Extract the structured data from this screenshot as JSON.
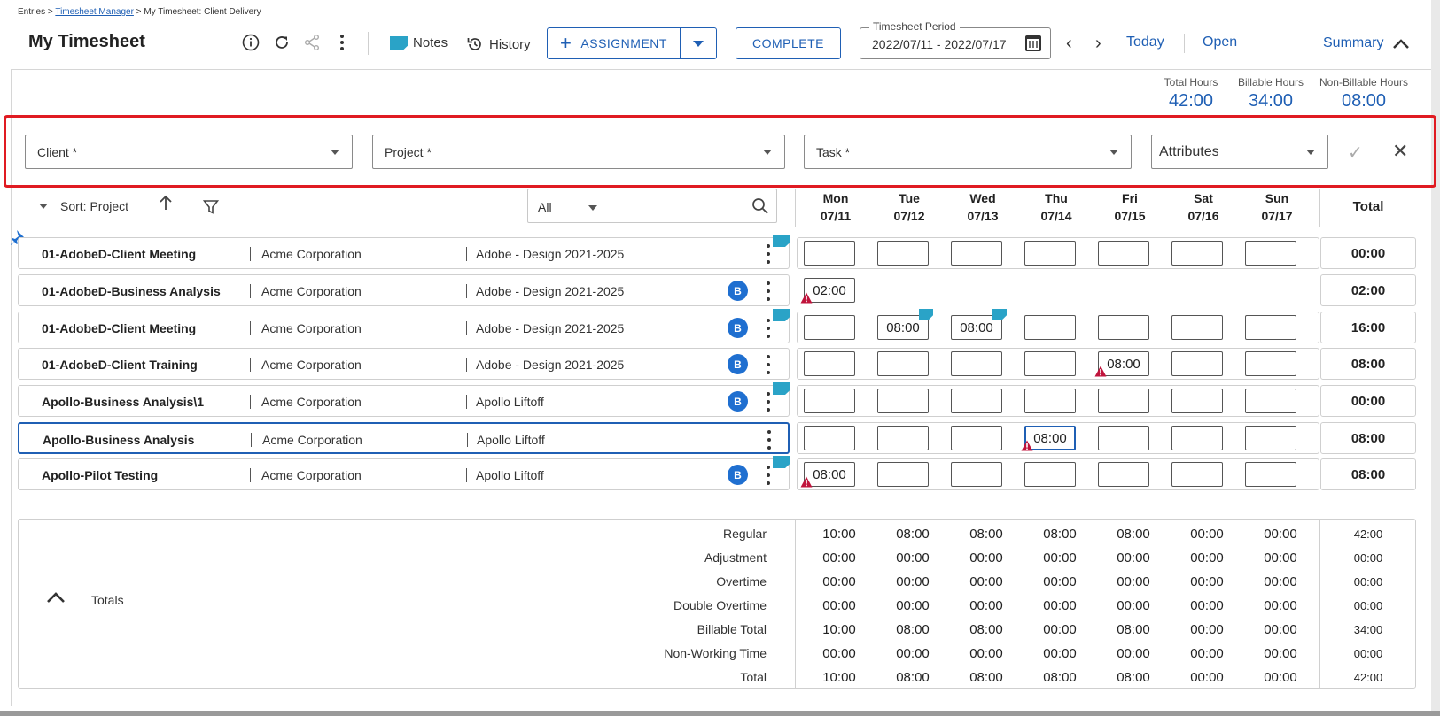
{
  "breadcrumb": {
    "entries": "Entries",
    "sep1": " > ",
    "manager": "Timesheet Manager",
    "sep2": " > ",
    "current": "My Timesheet: Client Delivery"
  },
  "header": {
    "title": "My Timesheet",
    "notes_label": "Notes",
    "history_label": "History",
    "assignment_label": "ASSIGNMENT",
    "complete_label": "COMPLETE",
    "period_label": "Timesheet Period",
    "period_value": "2022/07/11 - 2022/07/17",
    "today_label": "Today",
    "open_label": "Open",
    "summary_label": "Summary"
  },
  "stats": {
    "total_label": "Total Hours",
    "total_value": "42:00",
    "billable_label": "Billable Hours",
    "billable_value": "34:00",
    "nonbillable_label": "Non-Billable Hours",
    "nonbillable_value": "08:00"
  },
  "assignment_form": {
    "client": "Client *",
    "project": "Project *",
    "task": "Task *",
    "attributes": "Attributes"
  },
  "toolbar": {
    "sort_label": "Sort: Project",
    "filter_value": "All"
  },
  "days": [
    {
      "name": "Mon",
      "date": "07/11"
    },
    {
      "name": "Tue",
      "date": "07/12"
    },
    {
      "name": "Wed",
      "date": "07/13"
    },
    {
      "name": "Thu",
      "date": "07/14"
    },
    {
      "name": "Fri",
      "date": "07/15"
    },
    {
      "name": "Sat",
      "date": "07/16"
    },
    {
      "name": "Sun",
      "date": "07/17"
    }
  ],
  "total_header": "Total",
  "rows": [
    {
      "task": "01-AdobeD-Client Meeting",
      "client": "Acme Corporation",
      "project": "Adobe - Design 2021-2025",
      "badge": "",
      "total": "00:00",
      "hours": [
        "",
        "",
        "",
        "",
        "",
        "",
        ""
      ]
    },
    {
      "task": "01-AdobeD-Business Analysis",
      "client": "Acme Corporation",
      "project": "Adobe - Design 2021-2025",
      "badge": "B",
      "total": "02:00",
      "hours": [
        "02:00"
      ]
    },
    {
      "task": "01-AdobeD-Client Meeting",
      "client": "Acme Corporation",
      "project": "Adobe - Design 2021-2025",
      "badge": "B",
      "total": "16:00",
      "hours": [
        "",
        "08:00",
        "08:00",
        "",
        "",
        "",
        ""
      ]
    },
    {
      "task": "01-AdobeD-Client Training",
      "client": "Acme Corporation",
      "project": "Adobe - Design 2021-2025",
      "badge": "B",
      "total": "08:00",
      "hours": [
        "",
        "",
        "",
        "",
        "08:00",
        "",
        ""
      ]
    },
    {
      "task": "Apollo-Business Analysis\\1",
      "client": "Acme Corporation",
      "project": "Apollo Liftoff",
      "badge": "B",
      "total": "00:00",
      "hours": [
        "",
        "",
        "",
        "",
        "",
        "",
        ""
      ]
    },
    {
      "task": "Apollo-Business Analysis",
      "client": "Acme Corporation",
      "project": "Apollo Liftoff",
      "badge": "",
      "total": "08:00",
      "hours": [
        "",
        "",
        "",
        "08:00",
        "",
        "",
        ""
      ]
    },
    {
      "task": "Apollo-Pilot Testing",
      "client": "Acme Corporation",
      "project": "Apollo Liftoff",
      "badge": "B",
      "total": "08:00",
      "hours": [
        "08:00",
        "",
        "",
        "",
        "",
        "",
        ""
      ]
    }
  ],
  "totals": {
    "title": "Totals",
    "rows": [
      {
        "label": "Regular",
        "values": [
          "10:00",
          "08:00",
          "08:00",
          "08:00",
          "08:00",
          "00:00",
          "00:00"
        ],
        "sum": "42:00"
      },
      {
        "label": "Adjustment",
        "values": [
          "00:00",
          "00:00",
          "00:00",
          "00:00",
          "00:00",
          "00:00",
          "00:00"
        ],
        "sum": "00:00"
      },
      {
        "label": "Overtime",
        "values": [
          "00:00",
          "00:00",
          "00:00",
          "00:00",
          "00:00",
          "00:00",
          "00:00"
        ],
        "sum": "00:00"
      },
      {
        "label": "Double Overtime",
        "values": [
          "00:00",
          "00:00",
          "00:00",
          "00:00",
          "00:00",
          "00:00",
          "00:00"
        ],
        "sum": "00:00"
      },
      {
        "label": "Billable Total",
        "values": [
          "10:00",
          "08:00",
          "08:00",
          "00:00",
          "08:00",
          "00:00",
          "00:00"
        ],
        "sum": "34:00"
      },
      {
        "label": "Non-Working Time",
        "values": [
          "00:00",
          "00:00",
          "00:00",
          "00:00",
          "00:00",
          "00:00",
          "00:00"
        ],
        "sum": "00:00"
      },
      {
        "label": "Total",
        "values": [
          "10:00",
          "08:00",
          "08:00",
          "08:00",
          "08:00",
          "00:00",
          "00:00"
        ],
        "sum": "42:00"
      }
    ]
  },
  "colors": {
    "accent": "#1f5fb4",
    "highlight": "#e01b22",
    "note": "#2aa3c7",
    "warning": "#c0143c"
  }
}
